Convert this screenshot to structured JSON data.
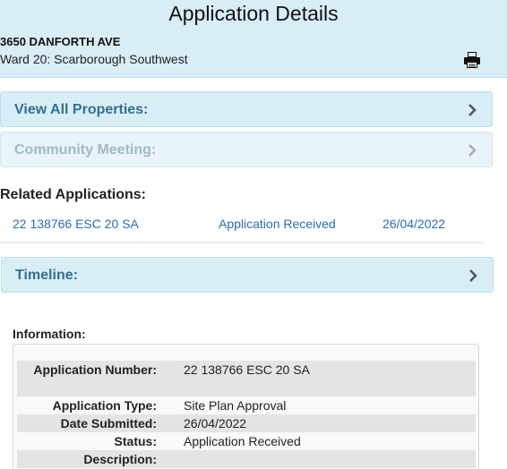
{
  "header": {
    "title": "Application Details",
    "address": "3650 DANFORTH AVE",
    "ward": "Ward 20: Scarborough Southwest",
    "print_icon": "printer-icon"
  },
  "panels": {
    "view_all_properties": "View All Properties:",
    "community_meeting": "Community Meeting:",
    "timeline": "Timeline:"
  },
  "related": {
    "title": "Related Applications:",
    "rows": [
      {
        "number": "22 138766 ESC 20 SA",
        "status": "Application Received",
        "date": "26/04/2022"
      }
    ]
  },
  "information": {
    "title": "Information:",
    "rows": [
      {
        "label": "Application Number:",
        "value": "22 138766 ESC 20 SA"
      },
      {
        "label": "Application Type:",
        "value": "Site Plan Approval"
      },
      {
        "label": "Date Submitted:",
        "value": "26/04/2022"
      },
      {
        "label": "Status:",
        "value": "Application Received"
      },
      {
        "label": "Description:",
        "value": ""
      }
    ]
  },
  "colors": {
    "header_bg": "#d9edf7",
    "panel_text": "#31708f",
    "link": "#2a6db3"
  }
}
